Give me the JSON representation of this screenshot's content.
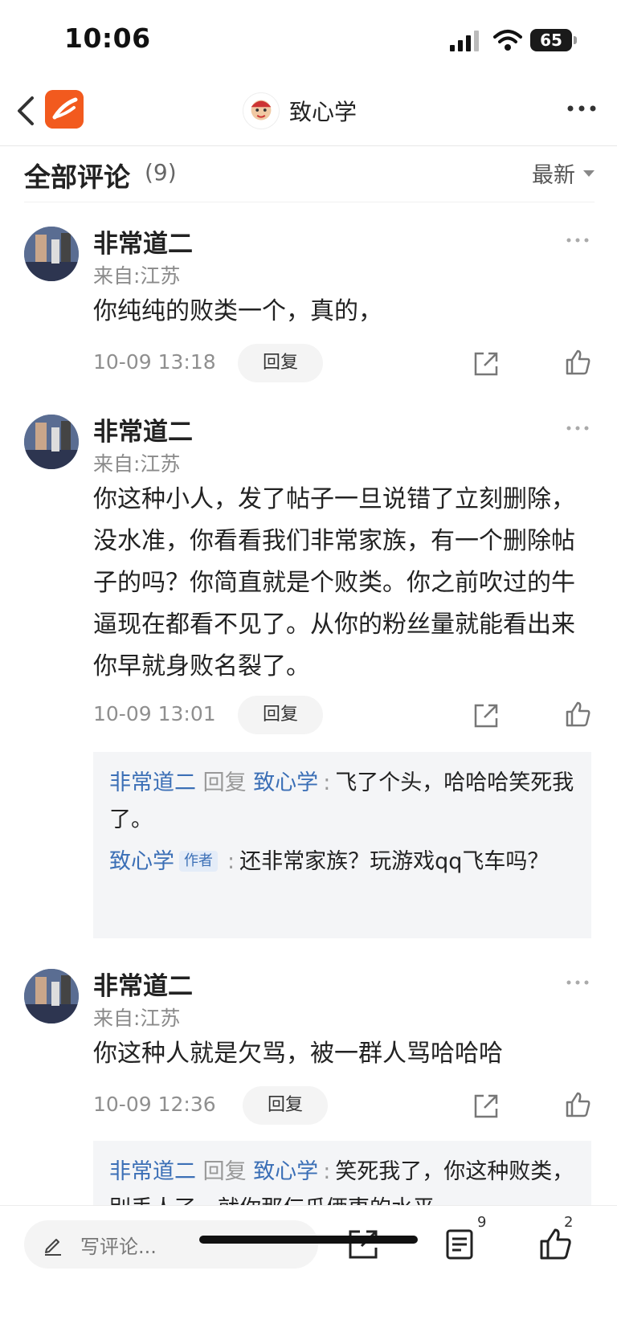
{
  "status": {
    "time": "10:06",
    "battery": "65"
  },
  "nav": {
    "title": "致心学"
  },
  "list": {
    "title": "全部评论",
    "count": "(9)",
    "sort_label": "最新"
  },
  "comments": [
    {
      "name": "非常道二",
      "location": "来自:江苏",
      "text": "你纯纯的败类一个，真的，",
      "time": "10-09 13:18",
      "reply_label": "回复"
    },
    {
      "name": "非常道二",
      "location": "来自:江苏",
      "text": "你这种小人，发了帖子一旦说错了立刻删除，没水准，你看看我们非常家族，有一个删除帖子的吗？你简直就是个败类。你之前吹过的牛逼现在都看不见了。从你的粉丝量就能看出来你早就身败名裂了。",
      "time": "10-09 13:01",
      "reply_label": "回复",
      "replies": [
        {
          "user": "非常道二",
          "verb": "回复",
          "target": "致心学",
          "colon": ":",
          "text": "飞了个头，哈哈哈笑死我了。"
        },
        {
          "user": "致心学",
          "tag": "作者",
          "colon": ":",
          "text": "还非常家族？玩游戏qq飞车吗？"
        }
      ]
    },
    {
      "name": "非常道二",
      "location": "来自:江苏",
      "text": "你这种人就是欠骂，被一群人骂哈哈哈",
      "time": "10-09 12:36",
      "reply_label": "回复",
      "replies": [
        {
          "user": "非常道二",
          "verb": "回复",
          "target": "致心学",
          "colon": ":",
          "text": "笑死我了，你这种败类，别丢人了，就你那仨瓜俩枣的水平"
        }
      ]
    }
  ],
  "bottom": {
    "placeholder": "写评论...",
    "comment_count": "9",
    "like_count": "2"
  },
  "colors": {
    "accent_blue": "#3b6fb6",
    "logo_orange": "#f25a1e"
  }
}
